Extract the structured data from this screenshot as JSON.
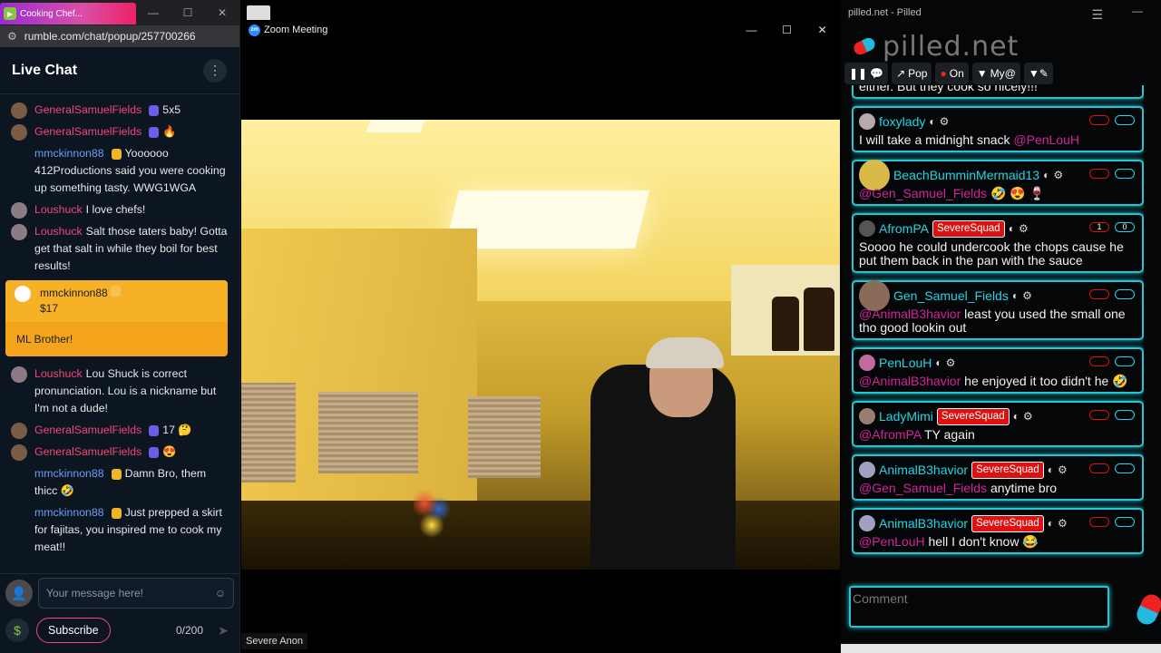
{
  "rumble": {
    "tab_title": "Cooking Chef...",
    "url": "rumble.com/chat/popup/257700266",
    "title": "Live Chat",
    "more_icon": "more-vertical-icon",
    "messages": [
      {
        "name": "GeneralSamuelFields",
        "text": "5x5",
        "color": "red",
        "avatar": "#7a5c45",
        "badge": "shield"
      },
      {
        "name": "GeneralSamuelFields",
        "text": "🔥",
        "color": "red",
        "avatar": "#7a5c45",
        "badge": "shield"
      },
      {
        "name": "mmckinnon88",
        "text": "Yoooooo 412Productions said you were cooking up something tasty. WWG1WGA",
        "color": "blue",
        "avatar": "none",
        "badge": "crown"
      },
      {
        "name": "Loushuck",
        "text": "I love chefs!",
        "color": "red",
        "avatar": "#8a7b84",
        "badge": ""
      },
      {
        "name": "Loushuck",
        "text": "Salt those taters baby! Gotta get that salt in while they boil for best results!",
        "color": "red",
        "avatar": "#8a7b84",
        "badge": ""
      }
    ],
    "rant": {
      "name": "mmckinnon88",
      "amount": "$17",
      "text": "ML Brother!"
    },
    "messages2": [
      {
        "name": "Loushuck",
        "text": "Lou Shuck is correct pronunciation. Lou is a nickname but I'm not a dude!",
        "color": "red",
        "avatar": "#8a7b84",
        "badge": ""
      },
      {
        "name": "GeneralSamuelFields",
        "text": "17 🤔",
        "color": "red",
        "avatar": "#7a5c45",
        "badge": "shield"
      },
      {
        "name": "GeneralSamuelFields",
        "text": "😍",
        "color": "red",
        "avatar": "#7a5c45",
        "badge": "shield"
      },
      {
        "name": "mmckinnon88",
        "text": "Damn Bro, them thicc 🤣",
        "color": "blue",
        "avatar": "none",
        "badge": "crown"
      },
      {
        "name": "mmckinnon88",
        "text": "Just prepped a skirt for fajitas, you inspired me to cook my meat!!",
        "color": "blue",
        "avatar": "none",
        "badge": "crown"
      }
    ],
    "input_placeholder": "Your message here!",
    "subscribe_label": "Subscribe",
    "char_count": "0/200"
  },
  "zoom": {
    "title": "Zoom Meeting",
    "participant": "Severe Anon"
  },
  "pilled": {
    "window_title": "pilled.net - Pilled",
    "logo_text": "pilled.net",
    "toolbar": {
      "pop": "Pop",
      "on": "On",
      "my": "My@"
    },
    "partial_text": "either. But they cook so nicely!!!",
    "messages": [
      {
        "name": "foxylady",
        "tag": "",
        "mention": "@PenLouH",
        "text": "I will take a midnight snack",
        "mention_first": false,
        "down": "",
        "up": ""
      },
      {
        "name": "BeachBumminMermaid13",
        "tag": "",
        "mention": "@Gen_Samuel_Fields",
        "text": "🤣 😍 🍷",
        "mention_first": true,
        "down": "",
        "up": ""
      },
      {
        "name": "AfromPA",
        "tag": "SevereSquad",
        "mention": "",
        "text": "Soooo he could undercook the chops cause he put them back in the pan with the sauce",
        "mention_first": true,
        "down": "1",
        "up": "0"
      },
      {
        "name": "Gen_Samuel_Fields",
        "tag": "",
        "mention": "@AnimalB3havior",
        "text": "least you used the small one tho good lookin out",
        "mention_first": true,
        "down": "",
        "up": ""
      },
      {
        "name": "PenLouH",
        "tag": "",
        "mention": "@AnimalB3havior",
        "text": "he enjoyed it too didn't he 🤣",
        "mention_first": true,
        "down": "",
        "up": ""
      },
      {
        "name": "LadyMimi",
        "tag": "SevereSquad",
        "mention": "@AfromPA",
        "text": "TY again",
        "mention_first": true,
        "down": "",
        "up": ""
      },
      {
        "name": "AnimalB3havior",
        "tag": "SevereSquad",
        "mention": "@Gen_Samuel_Fields",
        "text": "anytime bro",
        "mention_first": true,
        "down": "",
        "up": ""
      },
      {
        "name": "AnimalB3havior",
        "tag": "SevereSquad",
        "mention": "@PenLouH",
        "text": "hell I don't know 😂",
        "mention_first": true,
        "down": "",
        "up": ""
      }
    ],
    "comment_placeholder": "Comment"
  }
}
